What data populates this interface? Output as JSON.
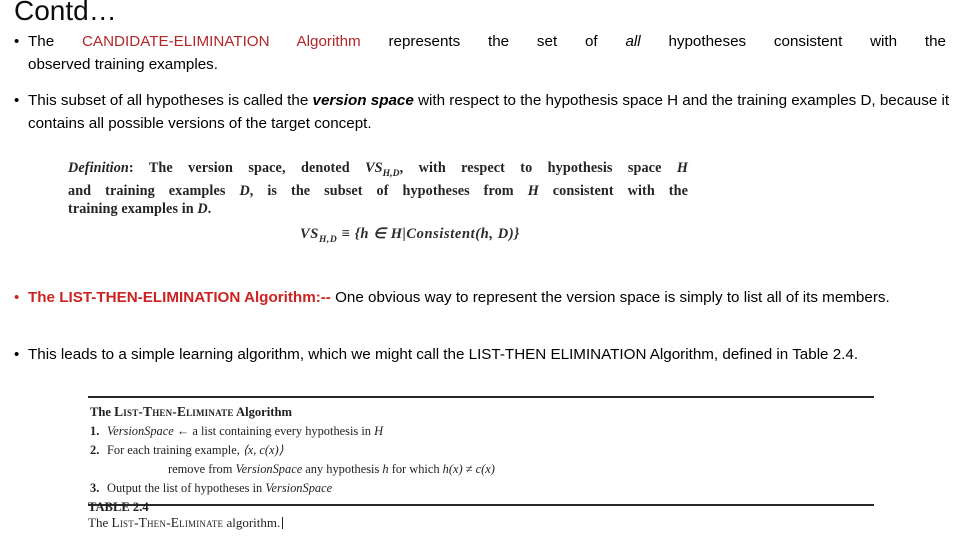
{
  "slide": {
    "title": "Contd…"
  },
  "colors": {
    "red_heading": "#b3262a",
    "red_bold": "#cc2222",
    "text": "#000000",
    "scan_ink": "#262626"
  },
  "bullets": [
    {
      "marker": "•",
      "marker_color": "black",
      "line1_pre": "The",
      "line1_red": "CANDIDATE-ELIMINATION  Algorithm",
      "line1_mid": "represents the set of",
      "line1_italic": "all",
      "line1_post": "hypotheses consistent with the",
      "line2": "observed training examples."
    },
    {
      "marker": "•",
      "marker_color": "black",
      "line1_pre": "This subset of all hypotheses is called the",
      "line1_bold_italic": "version space",
      "line1_post": "with respect to the hypothesis space H and the",
      "line2": "training examples D, because it contains all possible versions of the target concept."
    },
    {
      "marker": "•",
      "marker_color": "red",
      "line1_red_bold": "The LIST-THEN-ELIMINATION  Algorithm:--",
      "line1_post": "One obvious way to represent the version space is simply",
      "line2": "to list all of its members."
    },
    {
      "marker": "•",
      "marker_color": "black",
      "line1": "This leads to a simple learning algorithm, which we might call the LIST-THEN ELIMINATION Algorithm,",
      "line2": "defined in Table 2.4."
    }
  ],
  "definition_figure": {
    "line1_a": "Definition",
    "line1_b": ": The",
    "line1_c": "version space",
    "line1_d": ", denoted",
    "line1_e": "VS",
    "line1_sub": "H,D",
    "line1_f": ", with respect to hypothesis space",
    "line1_g": "H",
    "line2_a": "and training examples",
    "line2_b": "D",
    "line2_c": ", is the subset of hypotheses from",
    "line2_d": "H",
    "line2_e": "consistent with the",
    "line3_a": "training examples in",
    "line3_b": "D",
    "line3_c": ".",
    "formula": {
      "lhs": "VS",
      "lhs_sub": "H,D",
      "rel": "≡",
      "rhs": "{h ∈ H|Consistent(h, D)}"
    }
  },
  "algorithm_figure": {
    "heading_pre": "The ",
    "heading_sc": "List-Then-Eliminate",
    "heading_post": " Algorithm",
    "steps": [
      {
        "num": "1.",
        "var": "VersionSpace",
        "arrow": "←",
        "text": " a list containing every hypothesis in ",
        "tail_italic": "H"
      },
      {
        "num": "2.",
        "text": "For each training example, ",
        "tuple": "⟨x, c(x)⟩"
      },
      {
        "num": "3.",
        "text": "Output the list of hypotheses in ",
        "var": "VersionSpace"
      }
    ],
    "substep": {
      "pre": "remove from ",
      "var": "VersionSpace",
      "mid": " any hypothesis ",
      "h": "h",
      "post": " for which ",
      "cond": "h(x) ≠ c(x)"
    },
    "caption_line1": "TABLE 2.4",
    "caption_pre": "The ",
    "caption_sc": "List-Then-Eliminate",
    "caption_post": " algorithm."
  }
}
